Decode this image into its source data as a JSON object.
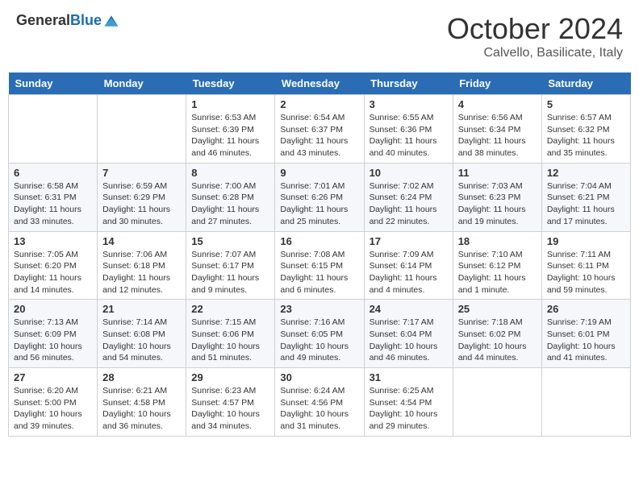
{
  "header": {
    "logo_general": "General",
    "logo_blue": "Blue",
    "month": "October 2024",
    "location": "Calvello, Basilicate, Italy"
  },
  "days_of_week": [
    "Sunday",
    "Monday",
    "Tuesday",
    "Wednesday",
    "Thursday",
    "Friday",
    "Saturday"
  ],
  "weeks": [
    [
      {
        "day": "",
        "info": ""
      },
      {
        "day": "",
        "info": ""
      },
      {
        "day": "1",
        "info": "Sunrise: 6:53 AM\nSunset: 6:39 PM\nDaylight: 11 hours and 46 minutes."
      },
      {
        "day": "2",
        "info": "Sunrise: 6:54 AM\nSunset: 6:37 PM\nDaylight: 11 hours and 43 minutes."
      },
      {
        "day": "3",
        "info": "Sunrise: 6:55 AM\nSunset: 6:36 PM\nDaylight: 11 hours and 40 minutes."
      },
      {
        "day": "4",
        "info": "Sunrise: 6:56 AM\nSunset: 6:34 PM\nDaylight: 11 hours and 38 minutes."
      },
      {
        "day": "5",
        "info": "Sunrise: 6:57 AM\nSunset: 6:32 PM\nDaylight: 11 hours and 35 minutes."
      }
    ],
    [
      {
        "day": "6",
        "info": "Sunrise: 6:58 AM\nSunset: 6:31 PM\nDaylight: 11 hours and 33 minutes."
      },
      {
        "day": "7",
        "info": "Sunrise: 6:59 AM\nSunset: 6:29 PM\nDaylight: 11 hours and 30 minutes."
      },
      {
        "day": "8",
        "info": "Sunrise: 7:00 AM\nSunset: 6:28 PM\nDaylight: 11 hours and 27 minutes."
      },
      {
        "day": "9",
        "info": "Sunrise: 7:01 AM\nSunset: 6:26 PM\nDaylight: 11 hours and 25 minutes."
      },
      {
        "day": "10",
        "info": "Sunrise: 7:02 AM\nSunset: 6:24 PM\nDaylight: 11 hours and 22 minutes."
      },
      {
        "day": "11",
        "info": "Sunrise: 7:03 AM\nSunset: 6:23 PM\nDaylight: 11 hours and 19 minutes."
      },
      {
        "day": "12",
        "info": "Sunrise: 7:04 AM\nSunset: 6:21 PM\nDaylight: 11 hours and 17 minutes."
      }
    ],
    [
      {
        "day": "13",
        "info": "Sunrise: 7:05 AM\nSunset: 6:20 PM\nDaylight: 11 hours and 14 minutes."
      },
      {
        "day": "14",
        "info": "Sunrise: 7:06 AM\nSunset: 6:18 PM\nDaylight: 11 hours and 12 minutes."
      },
      {
        "day": "15",
        "info": "Sunrise: 7:07 AM\nSunset: 6:17 PM\nDaylight: 11 hours and 9 minutes."
      },
      {
        "day": "16",
        "info": "Sunrise: 7:08 AM\nSunset: 6:15 PM\nDaylight: 11 hours and 6 minutes."
      },
      {
        "day": "17",
        "info": "Sunrise: 7:09 AM\nSunset: 6:14 PM\nDaylight: 11 hours and 4 minutes."
      },
      {
        "day": "18",
        "info": "Sunrise: 7:10 AM\nSunset: 6:12 PM\nDaylight: 11 hours and 1 minute."
      },
      {
        "day": "19",
        "info": "Sunrise: 7:11 AM\nSunset: 6:11 PM\nDaylight: 10 hours and 59 minutes."
      }
    ],
    [
      {
        "day": "20",
        "info": "Sunrise: 7:13 AM\nSunset: 6:09 PM\nDaylight: 10 hours and 56 minutes."
      },
      {
        "day": "21",
        "info": "Sunrise: 7:14 AM\nSunset: 6:08 PM\nDaylight: 10 hours and 54 minutes."
      },
      {
        "day": "22",
        "info": "Sunrise: 7:15 AM\nSunset: 6:06 PM\nDaylight: 10 hours and 51 minutes."
      },
      {
        "day": "23",
        "info": "Sunrise: 7:16 AM\nSunset: 6:05 PM\nDaylight: 10 hours and 49 minutes."
      },
      {
        "day": "24",
        "info": "Sunrise: 7:17 AM\nSunset: 6:04 PM\nDaylight: 10 hours and 46 minutes."
      },
      {
        "day": "25",
        "info": "Sunrise: 7:18 AM\nSunset: 6:02 PM\nDaylight: 10 hours and 44 minutes."
      },
      {
        "day": "26",
        "info": "Sunrise: 7:19 AM\nSunset: 6:01 PM\nDaylight: 10 hours and 41 minutes."
      }
    ],
    [
      {
        "day": "27",
        "info": "Sunrise: 6:20 AM\nSunset: 5:00 PM\nDaylight: 10 hours and 39 minutes."
      },
      {
        "day": "28",
        "info": "Sunrise: 6:21 AM\nSunset: 4:58 PM\nDaylight: 10 hours and 36 minutes."
      },
      {
        "day": "29",
        "info": "Sunrise: 6:23 AM\nSunset: 4:57 PM\nDaylight: 10 hours and 34 minutes."
      },
      {
        "day": "30",
        "info": "Sunrise: 6:24 AM\nSunset: 4:56 PM\nDaylight: 10 hours and 31 minutes."
      },
      {
        "day": "31",
        "info": "Sunrise: 6:25 AM\nSunset: 4:54 PM\nDaylight: 10 hours and 29 minutes."
      },
      {
        "day": "",
        "info": ""
      },
      {
        "day": "",
        "info": ""
      }
    ]
  ]
}
